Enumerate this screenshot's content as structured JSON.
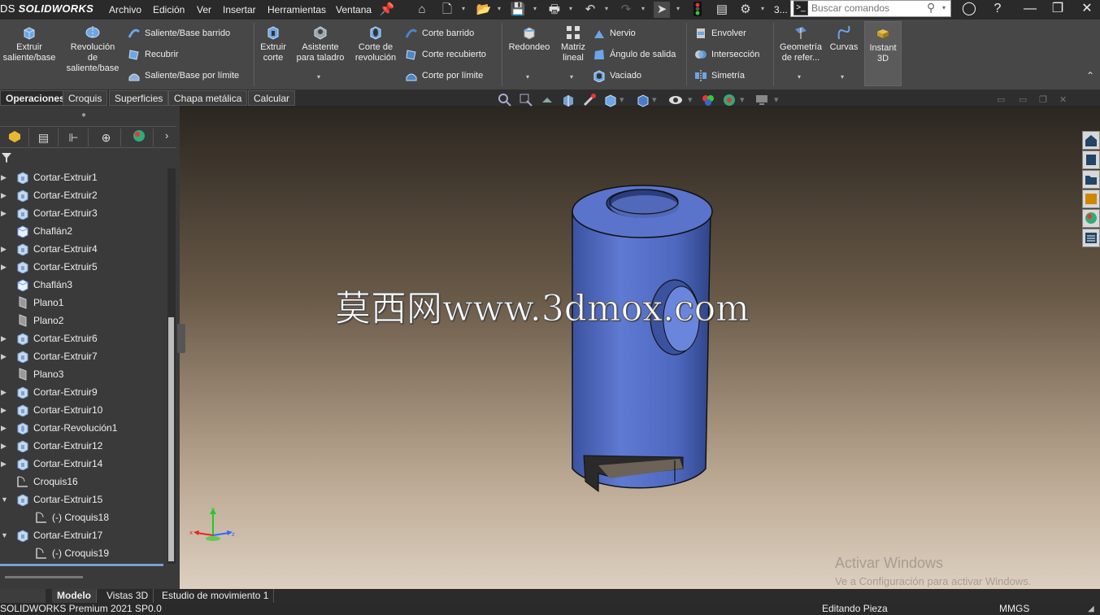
{
  "app": {
    "logo_prefix": "DS",
    "logo_name": "SOLIDWORKS"
  },
  "menu": [
    "Archivo",
    "Edición",
    "Ver",
    "Insertar",
    "Herramientas",
    "Ventana"
  ],
  "search": {
    "placeholder": "Buscar comandos",
    "prefix": "3..."
  },
  "ribbon": {
    "extruir_saliente": "Extruir saliente/base",
    "revolucion_saliente": "Revolución de saliente/base",
    "saliente_barrido": "Saliente/Base barrido",
    "recubrir": "Recubrir",
    "saliente_limite": "Saliente/Base por límite",
    "extruir_corte": "Extruir corte",
    "asistente_taladro": "Asistente para taladro",
    "corte_revolucion": "Corte de revolución",
    "corte_barrido": "Corte barrido",
    "corte_recubierto": "Corte recubierto",
    "corte_limite": "Corte por límite",
    "redondeo": "Redondeo",
    "matriz_lineal": "Matriz lineal",
    "nervio": "Nervio",
    "angulo_salida": "Ángulo de salida",
    "vaciado": "Vaciado",
    "envolver": "Envolver",
    "interseccion": "Intersección",
    "simetria": "Simetría",
    "geometria_ref": "Geometría de refer...",
    "curvas": "Curvas",
    "instant3d": "Instant 3D"
  },
  "tabs": [
    "Operaciones",
    "Croquis",
    "Superficies",
    "Chapa metálica",
    "Calcular"
  ],
  "tree": [
    {
      "label": "Cortar-Extruir1",
      "icon": "cut-extrude",
      "expandable": true,
      "expanded": false,
      "indent": 0
    },
    {
      "label": "Cortar-Extruir2",
      "icon": "cut-extrude",
      "expandable": true,
      "expanded": false,
      "indent": 0
    },
    {
      "label": "Cortar-Extruir3",
      "icon": "cut-extrude",
      "expandable": true,
      "expanded": false,
      "indent": 0
    },
    {
      "label": "Chaflán2",
      "icon": "chamfer",
      "expandable": false,
      "expanded": false,
      "indent": 0
    },
    {
      "label": "Cortar-Extruir4",
      "icon": "cut-extrude",
      "expandable": true,
      "expanded": false,
      "indent": 0
    },
    {
      "label": "Cortar-Extruir5",
      "icon": "cut-extrude",
      "expandable": true,
      "expanded": false,
      "indent": 0
    },
    {
      "label": "Chaflán3",
      "icon": "chamfer",
      "expandable": false,
      "expanded": false,
      "indent": 0
    },
    {
      "label": "Plano1",
      "icon": "plane",
      "expandable": false,
      "expanded": false,
      "indent": 0
    },
    {
      "label": "Plano2",
      "icon": "plane",
      "expandable": false,
      "expanded": false,
      "indent": 0
    },
    {
      "label": "Cortar-Extruir6",
      "icon": "cut-extrude",
      "expandable": true,
      "expanded": false,
      "indent": 0
    },
    {
      "label": "Cortar-Extruir7",
      "icon": "cut-extrude",
      "expandable": true,
      "expanded": false,
      "indent": 0
    },
    {
      "label": "Plano3",
      "icon": "plane",
      "expandable": false,
      "expanded": false,
      "indent": 0
    },
    {
      "label": "Cortar-Extruir9",
      "icon": "cut-extrude",
      "expandable": true,
      "expanded": false,
      "indent": 0
    },
    {
      "label": "Cortar-Extruir10",
      "icon": "cut-extrude",
      "expandable": true,
      "expanded": false,
      "indent": 0
    },
    {
      "label": "Cortar-Revolución1",
      "icon": "cut-revolve",
      "expandable": true,
      "expanded": false,
      "indent": 0
    },
    {
      "label": "Cortar-Extruir12",
      "icon": "cut-extrude",
      "expandable": true,
      "expanded": false,
      "indent": 0
    },
    {
      "label": "Cortar-Extruir14",
      "icon": "cut-extrude",
      "expandable": true,
      "expanded": false,
      "indent": 0
    },
    {
      "label": "Croquis16",
      "icon": "sketch",
      "expandable": false,
      "expanded": false,
      "indent": 0
    },
    {
      "label": "Cortar-Extruir15",
      "icon": "cut-extrude",
      "expandable": true,
      "expanded": true,
      "indent": 0
    },
    {
      "label": "(-) Croquis18",
      "icon": "sketch",
      "expandable": false,
      "expanded": false,
      "indent": 1
    },
    {
      "label": "Cortar-Extruir17",
      "icon": "cut-extrude",
      "expandable": true,
      "expanded": true,
      "indent": 0
    },
    {
      "label": "(-) Croquis19",
      "icon": "sketch",
      "expandable": false,
      "expanded": false,
      "indent": 1
    }
  ],
  "bottom_tabs": [
    "Modelo",
    "Vistas 3D",
    "Estudio de movimiento 1"
  ],
  "watermark": "莫西网www.3dmox.com",
  "activation": {
    "title": "Activar Windows",
    "subtitle": "Ve a Configuración para activar Windows."
  },
  "status": {
    "left": "SOLIDWORKS Premium 2021 SP0.0",
    "mode": "Editando Pieza",
    "units": "MMGS"
  },
  "colors": {
    "model_blue": "#5471c8",
    "ribbon_bg": "#474747"
  }
}
